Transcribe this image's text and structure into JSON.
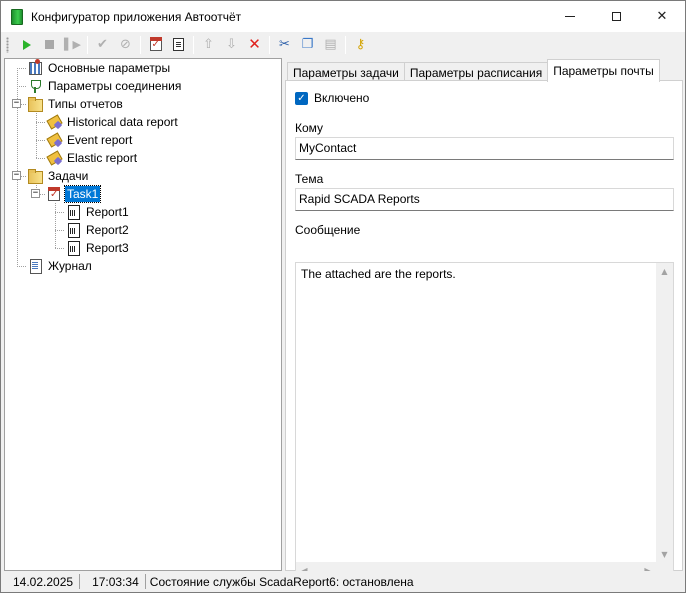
{
  "window": {
    "title": "Конфигуратор приложения Автоотчёт",
    "controls": {
      "minimize": "",
      "maximize": "",
      "close": "✕"
    }
  },
  "toolbar": {
    "buttons": [
      {
        "name": "start-service",
        "icon": "play-icon",
        "enabled": true
      },
      {
        "name": "stop-service",
        "icon": "stop-icon",
        "enabled": false
      },
      {
        "name": "restart-service",
        "icon": "restart-icon",
        "enabled": false
      },
      {
        "name": "apply",
        "icon": "checkmark-icon",
        "enabled": false
      },
      {
        "name": "cancel",
        "icon": "cancel-icon",
        "enabled": false
      },
      {
        "name": "add-task",
        "icon": "task-icon",
        "enabled": true
      },
      {
        "name": "add-report",
        "icon": "report-icon",
        "enabled": true
      },
      {
        "name": "move-up",
        "icon": "arrow-up-icon",
        "enabled": false
      },
      {
        "name": "move-down",
        "icon": "arrow-down-icon",
        "enabled": false
      },
      {
        "name": "delete",
        "icon": "delete-icon",
        "enabled": true
      },
      {
        "name": "cut",
        "icon": "scissors-icon",
        "enabled": true
      },
      {
        "name": "copy",
        "icon": "copy-icon",
        "enabled": true
      },
      {
        "name": "paste",
        "icon": "paste-icon",
        "enabled": false
      },
      {
        "name": "keys",
        "icon": "key-icon",
        "enabled": true
      }
    ]
  },
  "tree": {
    "general": "Основные параметры",
    "connection": "Параметры соединения",
    "report_types": "Типы отчетов",
    "historical": "Historical data report",
    "event": "Event report",
    "elastic": "Elastic report",
    "tasks": "Задачи",
    "task1": "Task1",
    "report1": "Report1",
    "report2": "Report2",
    "report3": "Report3",
    "log": "Журнал",
    "expanders": {
      "expanded": "−"
    }
  },
  "tabs": {
    "task_params": "Параметры задачи",
    "schedule_params": "Параметры расписания",
    "mail_params": "Параметры почты",
    "active": "mail_params"
  },
  "mail": {
    "enabled_label": "Включено",
    "enabled": true,
    "checkmark": "✓",
    "to_label": "Кому",
    "to_value": "MyContact",
    "subject_label": "Тема",
    "subject_value": "Rapid SCADA Reports",
    "message_label": "Сообщение",
    "message_value": "The attached are the reports."
  },
  "scroll_arrows": {
    "up": "▲",
    "down": "▼",
    "left": "◀",
    "right": "▶"
  },
  "status": {
    "date": "14.02.2025",
    "time": "17:03:34",
    "service_state": "Состояние службы ScadaReport6: остановлена"
  },
  "colors": {
    "selection": "#0078d7",
    "checkbox": "#0067c0",
    "delete_red": "#e0201c",
    "play_green": "#2bb32b"
  }
}
